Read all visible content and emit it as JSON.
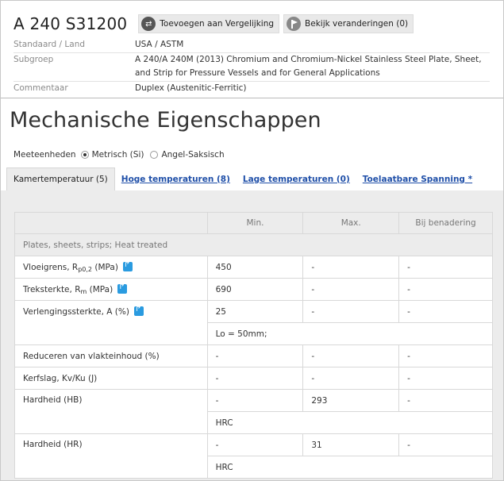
{
  "header": {
    "grade": "A 240 S31200",
    "compare_label": "Toevoegen aan Vergelijking",
    "changes_label": "Bekijk veranderingen (0)"
  },
  "meta": [
    {
      "label": "Standaard / Land",
      "value": "USA / ASTM"
    },
    {
      "label": "Subgroep",
      "value": "A 240/A 240M (2013) Chromium and Chromium-Nickel Stainless Steel Plate, Sheet, and Strip for Pressure Vessels and for General Applications"
    },
    {
      "label": "Commentaar",
      "value": "Duplex (Austenitic-Ferritic)"
    }
  ],
  "section_title": "Mechanische Eigenschappen",
  "units": {
    "label": "Meeteenheden",
    "metric": "Metrisch (Si)",
    "imperial": "Angel-Saksisch",
    "selected": "metric"
  },
  "tabs": [
    {
      "label": "Kamertemperatuur (5)",
      "active": true
    },
    {
      "label": "Hoge temperaturen (8)",
      "active": false
    },
    {
      "label": "Lage temperaturen (0)",
      "active": false
    },
    {
      "label": "Toelaatbare Spanning *",
      "active": false
    }
  ],
  "table": {
    "headers": [
      "",
      "Min.",
      "Max.",
      "Bij benadering"
    ],
    "group": "Plates, sheets, strips; Heat treated",
    "rows": [
      {
        "prop": "Vloeigrens, R",
        "sub": "p0,2",
        "unit": " (MPa)",
        "min": "450",
        "max": "-",
        "approx": "-"
      },
      {
        "prop": "Treksterkte, R",
        "sub": "m",
        "unit": " (MPa)",
        "min": "690",
        "max": "-",
        "approx": "-"
      },
      {
        "prop": "Verlengingssterkte, A (%)",
        "min": "25",
        "max": "-",
        "approx": "-",
        "note": "Lo = 50mm;"
      },
      {
        "prop": "Reduceren van vlakteinhoud (%)",
        "min": "-",
        "max": "-",
        "approx": "-"
      },
      {
        "prop": "Kerfslag, Kv/Ku (J)",
        "min": "-",
        "max": "-",
        "approx": "-"
      },
      {
        "prop": "Hardheid (HB)",
        "min": "-",
        "max": "293",
        "approx": "-",
        "note": "HRC"
      },
      {
        "prop": "Hardheid (HR)",
        "min": "-",
        "max": "31",
        "approx": "-",
        "note": "HRC"
      }
    ]
  }
}
